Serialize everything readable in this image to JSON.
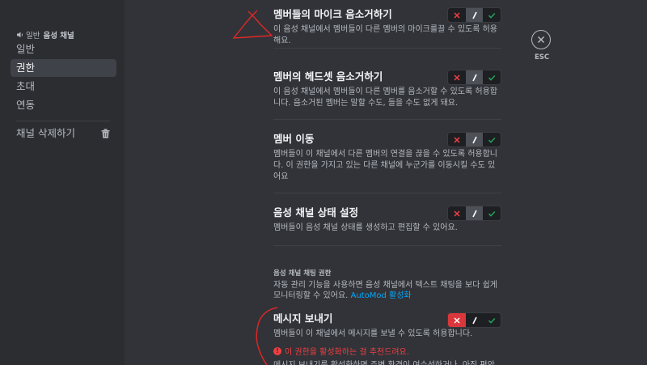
{
  "sidebar": {
    "header_prefix": "일반",
    "header_channel": "음성 채널",
    "items": [
      {
        "label": "일반"
      },
      {
        "label": "권한"
      },
      {
        "label": "초대"
      },
      {
        "label": "연동"
      }
    ],
    "delete_label": "채널 삭제하기"
  },
  "permissions": [
    {
      "title": "멤버들의 마이크 음소거하기",
      "desc": "이 음성 채널에서 멤버들이 다른 멤버의 마이크를끌 수 있도록 허용해요.",
      "state": "allow"
    },
    {
      "title": "멤버의 헤드셋 음소거하기",
      "desc": "이 음성 채널에서 멤버들이 다른 멤버를 음소거할 수 있도록 허용합니다. 음소거된 멤버는 말할 수도, 들을 수도 없게 돼요.",
      "state": "allow"
    },
    {
      "title": "멤버 이동",
      "desc": "멤버들이 이 채널에서 다른 멤버의 연결을 끊을 수 있도록 허용합니다. 이 권한을 가지고 있는 다른 채널에 누군가를 이동시킬 수도 있어요",
      "state": "allow"
    },
    {
      "title": "음성 채널 상태 설정",
      "desc": "멤버들이 음성 채널 상태를 생성하고 편집할 수 있어요.",
      "state": "allow"
    }
  ],
  "text_section": {
    "header": "음성 채널 채팅 권한",
    "desc": "자동 관리 기능을 사용하면 음성 채널에서 텍스트 채팅을 보다 쉽게 모니터링할 수 있어요.",
    "link": "AutoMod 활성화"
  },
  "send_messages": {
    "title": "메시지 보내기",
    "desc": "멤버들이 이 채널에서 메시지를 보낼 수 있도록 허용합니다.",
    "warning": "이 권한을 활성화하는 걸 추천드려요.",
    "cut_text": "메시지 보내기를 활성화하면 주변 환경이 여수선하거나, 아직 편안",
    "state": "deny"
  },
  "close": {
    "label": "ESC"
  },
  "colors": {
    "deny": "#f23f43",
    "allow": "#23a55a",
    "annotation": "#e02727"
  }
}
